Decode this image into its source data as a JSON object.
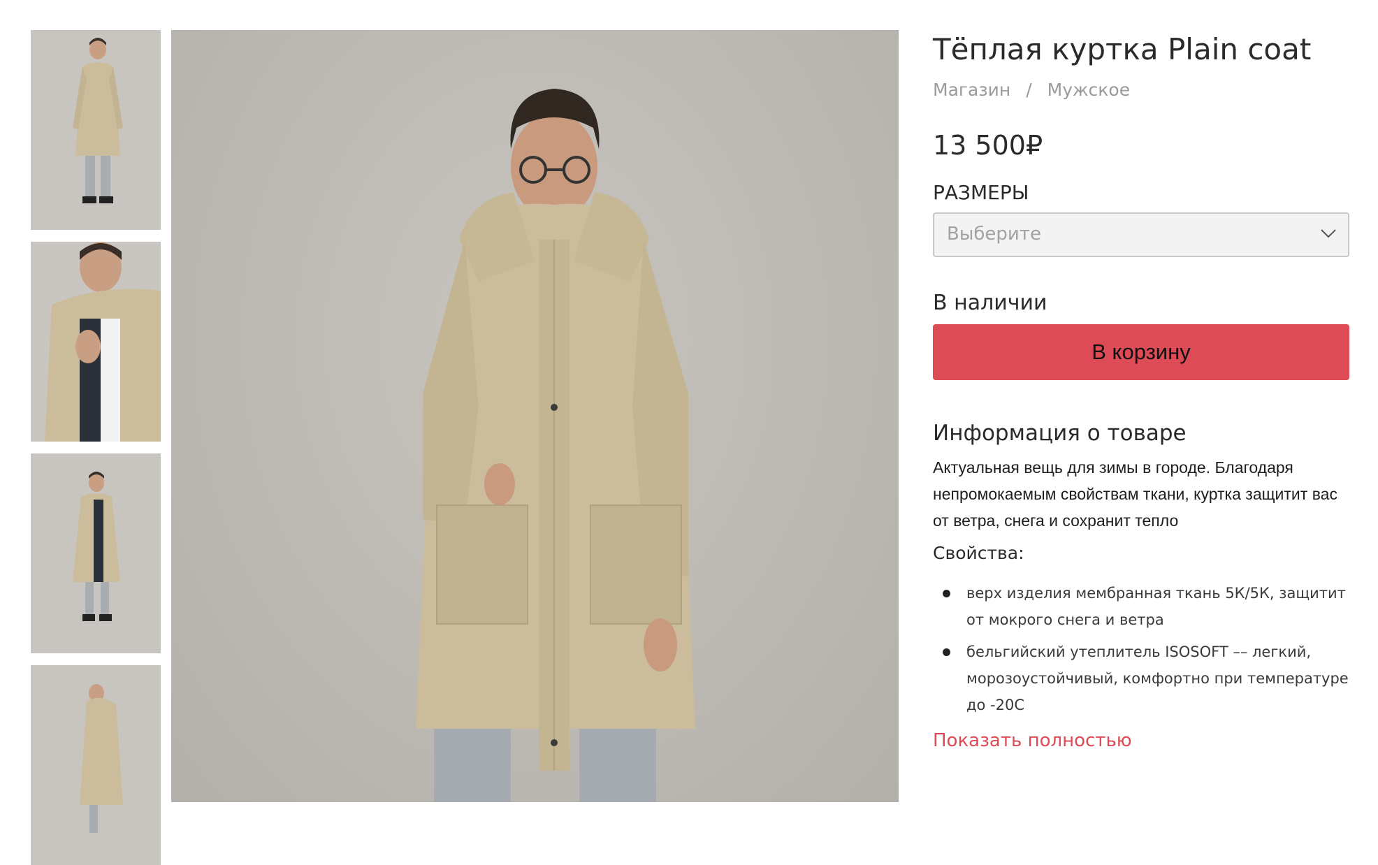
{
  "product": {
    "title": "Тёплая куртка Plain coat",
    "breadcrumb": [
      "Магазин",
      "Мужское"
    ],
    "breadcrumb_separator": "/",
    "price": "13 500₽",
    "sizes_label": "РАЗМЕРЫ",
    "size_placeholder": "Выберите",
    "stock_status": "В наличии",
    "add_to_cart_label": "В корзину",
    "info_title": "Информация о товаре",
    "description": "Актуальная вещь для зимы в городе. Благодаря непромокаемым свойствам ткани, куртка защитит вас от ветра, снега и сохранит тепло",
    "properties_title": "Свойства:",
    "properties": [
      "верх изделия мембранная ткань 5К/5К, защитит от мокрого снега и ветра",
      "бельгийский утеплитель ISOSOFT –– легкий, морозоустойчивый, комфортно при температуре до -20С"
    ],
    "show_more_label": "Показать полностью"
  },
  "gallery": {
    "selected_index": 0,
    "thumbnails": [
      {
        "alt": "front-full"
      },
      {
        "alt": "close-up"
      },
      {
        "alt": "side-open"
      },
      {
        "alt": "back-side"
      }
    ]
  },
  "colors": {
    "accent": "#dc4b56",
    "coat": "#cbbd9c",
    "background_photo": "#bfbbb6"
  },
  "icons": {
    "select_chevron": "chevron-down-icon"
  }
}
